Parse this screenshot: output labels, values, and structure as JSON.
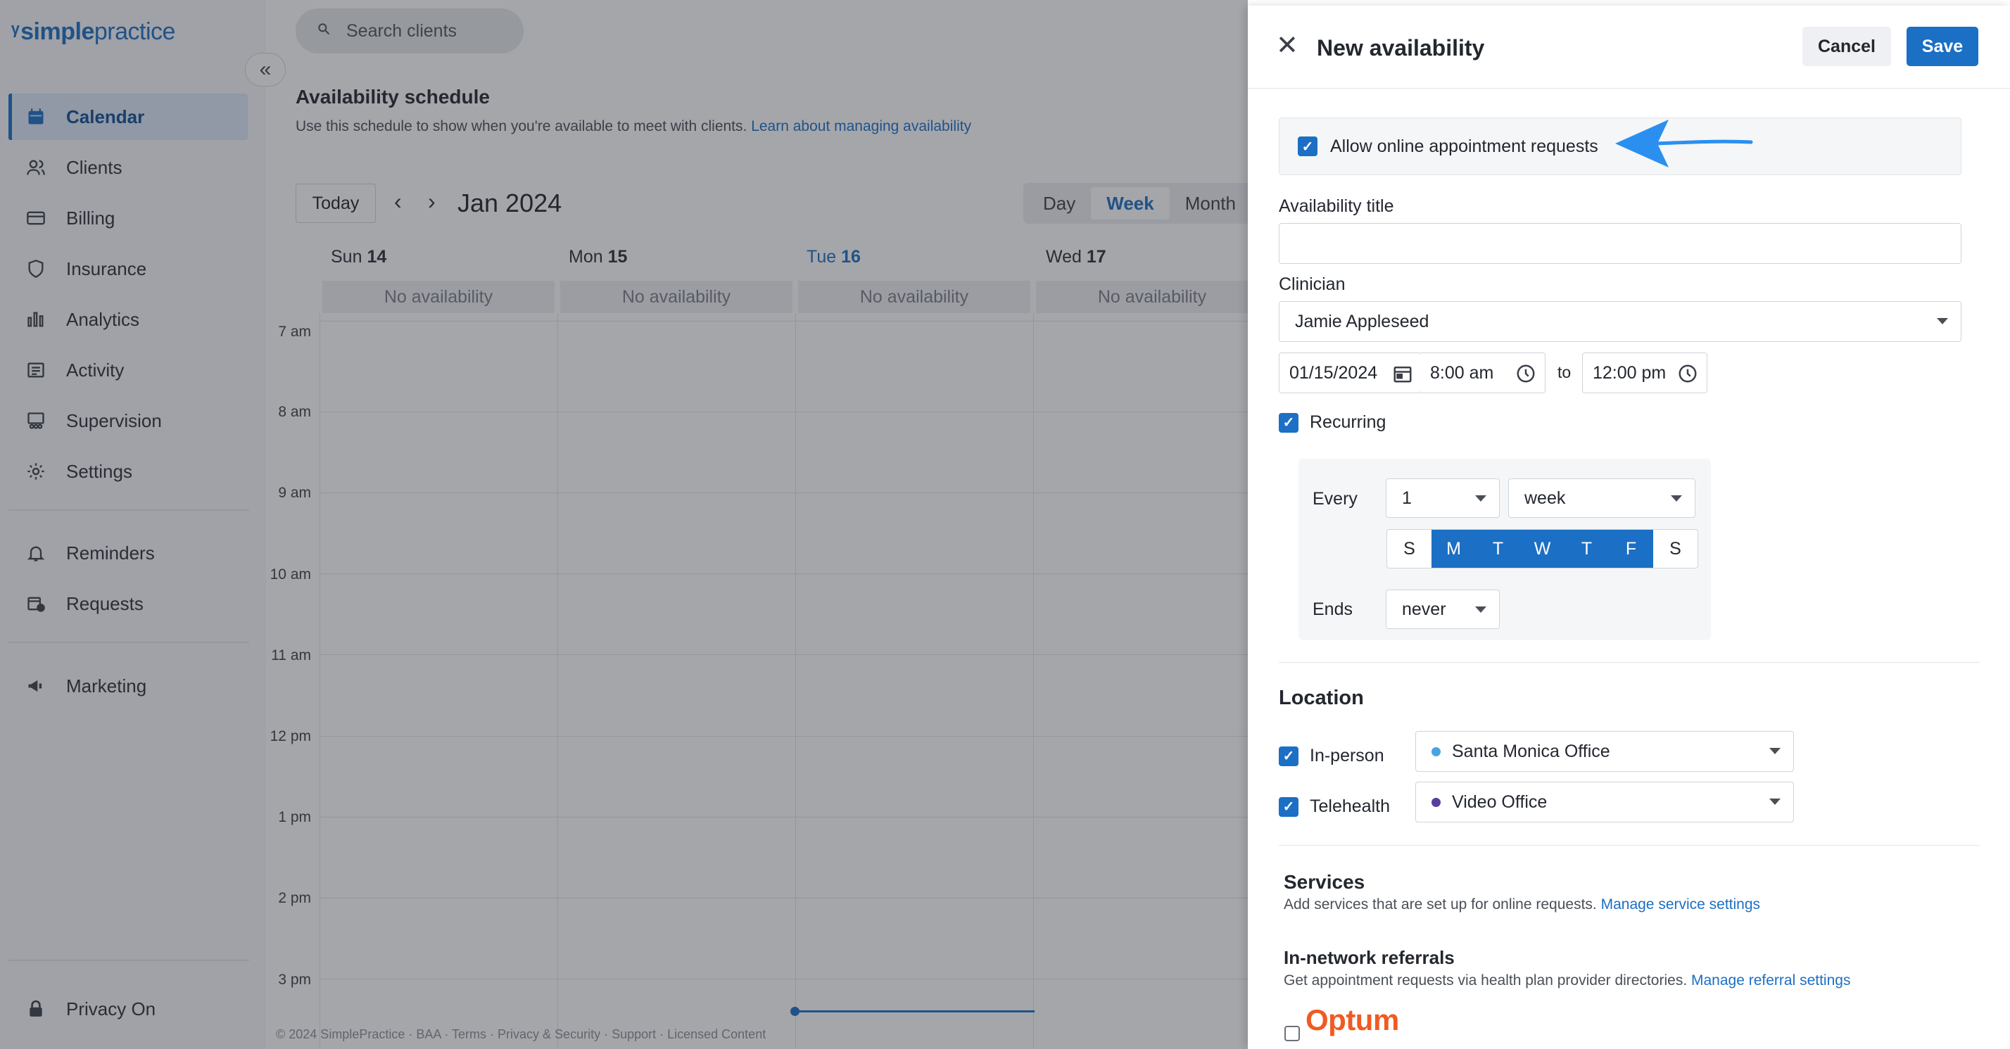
{
  "brand": {
    "logo_prefix": "simple",
    "logo_suffix": "practice"
  },
  "sidebar": {
    "items": [
      {
        "label": "Calendar",
        "icon": "calendar-icon",
        "active": true
      },
      {
        "label": "Clients",
        "icon": "users-icon"
      },
      {
        "label": "Billing",
        "icon": "credit-card-icon"
      },
      {
        "label": "Insurance",
        "icon": "shield-icon"
      },
      {
        "label": "Analytics",
        "icon": "bar-chart-icon"
      },
      {
        "label": "Activity",
        "icon": "list-icon"
      },
      {
        "label": "Supervision",
        "icon": "supervision-icon"
      },
      {
        "label": "Settings",
        "icon": "gear-icon"
      },
      {
        "label": "Reminders",
        "icon": "bell-icon"
      },
      {
        "label": "Requests",
        "icon": "calendar-request-icon"
      },
      {
        "label": "Marketing",
        "icon": "megaphone-icon"
      }
    ],
    "privacy": {
      "label": "Privacy On",
      "icon": "lock-icon"
    }
  },
  "search": {
    "placeholder": "Search clients"
  },
  "schedule": {
    "title": "Availability schedule",
    "subtitle": "Use this schedule to show when you're available to meet with clients.",
    "link": "Learn about managing availability"
  },
  "calendar": {
    "today_label": "Today",
    "month_label": "Jan 2024",
    "views": [
      "Day",
      "Week",
      "Month"
    ],
    "active_view": "Week",
    "days": [
      {
        "name": "Sun",
        "num": "14",
        "status": "No availability"
      },
      {
        "name": "Mon",
        "num": "15",
        "status": "No availability"
      },
      {
        "name": "Tue",
        "num": "16",
        "status": "No availability",
        "current": true
      },
      {
        "name": "Wed",
        "num": "17",
        "status": "No availability"
      }
    ],
    "hours": [
      "7 am",
      "8 am",
      "9 am",
      "10 am",
      "11 am",
      "12 pm",
      "1 pm",
      "2 pm",
      "3 pm"
    ],
    "footer": "© 2024 SimplePractice · BAA · Terms · Privacy & Security · Support · Licensed Content"
  },
  "drawer": {
    "title": "New availability",
    "cancel_label": "Cancel",
    "save_label": "Save",
    "allow_online": {
      "label": "Allow online appointment requests",
      "checked": true
    },
    "availability_title": {
      "label": "Availability title",
      "value": ""
    },
    "clinician": {
      "label": "Clinician",
      "value": "Jamie Appleseed"
    },
    "date": "01/15/2024",
    "start_time": "8:00 am",
    "to_label": "to",
    "end_time": "12:00 pm",
    "recurring": {
      "label": "Recurring",
      "checked": true
    },
    "every_label": "Every",
    "every_value": "1",
    "every_unit": "week",
    "weekdays": [
      {
        "label": "S",
        "on": false
      },
      {
        "label": "M",
        "on": true
      },
      {
        "label": "T",
        "on": true
      },
      {
        "label": "W",
        "on": true
      },
      {
        "label": "T",
        "on": true
      },
      {
        "label": "F",
        "on": true
      },
      {
        "label": "S",
        "on": false
      }
    ],
    "ends_label": "Ends",
    "ends_value": "never",
    "location": {
      "heading": "Location",
      "in_person": {
        "label": "In-person",
        "checked": true,
        "value": "Santa Monica Office",
        "dot_color": "#4aa3df"
      },
      "telehealth": {
        "label": "Telehealth",
        "checked": true,
        "value": "Video Office",
        "dot_color": "#5a3e9e"
      }
    },
    "services": {
      "heading": "Services",
      "text": "Add services that are set up for online requests.",
      "link": "Manage service settings"
    },
    "referrals": {
      "heading": "In-network referrals",
      "text": "Get appointment requests via health plan provider directories.",
      "link": "Manage referral settings",
      "optum_label": "Optum",
      "optum_checked": false
    }
  },
  "colors": {
    "accent": "#1b6fc4",
    "annotation_arrow": "#2b8ff0"
  }
}
